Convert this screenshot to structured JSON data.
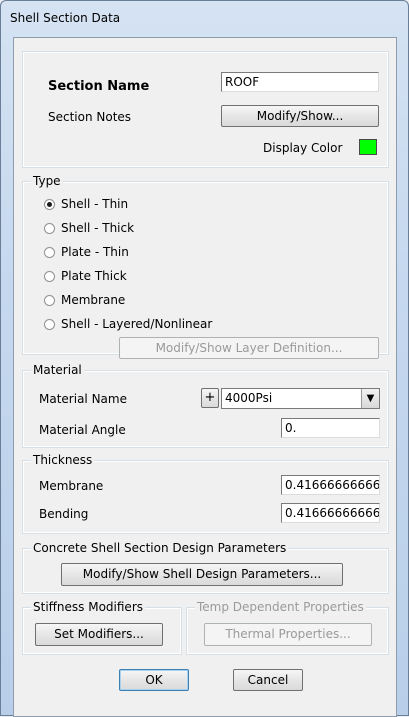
{
  "window": {
    "title": "Shell Section Data"
  },
  "section": {
    "name_label": "Section Name",
    "name_value": "ROOF",
    "notes_label": "Section Notes",
    "notes_button": "Modify/Show...",
    "color_label": "Display Color",
    "display_color": "#00ff00"
  },
  "type": {
    "legend": "Type",
    "options": [
      {
        "label": "Shell - Thin",
        "selected": true
      },
      {
        "label": "Shell - Thick",
        "selected": false
      },
      {
        "label": "Plate - Thin",
        "selected": false
      },
      {
        "label": "Plate Thick",
        "selected": false
      },
      {
        "label": "Membrane",
        "selected": false
      },
      {
        "label": "Shell - Layered/Nonlinear",
        "selected": false
      }
    ],
    "layer_button": "Modify/Show Layer Definition..."
  },
  "material": {
    "legend": "Material",
    "name_label": "Material Name",
    "add_button": "+",
    "name_value": "4000Psi",
    "angle_label": "Material Angle",
    "angle_value": "0."
  },
  "thickness": {
    "legend": "Thickness",
    "membrane_label": "Membrane",
    "membrane_value": "0.416666666666",
    "bending_label": "Bending",
    "bending_value": "0.416666666666"
  },
  "design": {
    "legend": "Concrete Shell Section Design Parameters",
    "button": "Modify/Show Shell Design Parameters..."
  },
  "stiffness": {
    "legend": "Stiffness Modifiers",
    "button": "Set Modifiers..."
  },
  "temp": {
    "legend": "Temp Dependent Properties",
    "button": "Thermal Properties..."
  },
  "footer": {
    "ok": "OK",
    "cancel": "Cancel"
  }
}
